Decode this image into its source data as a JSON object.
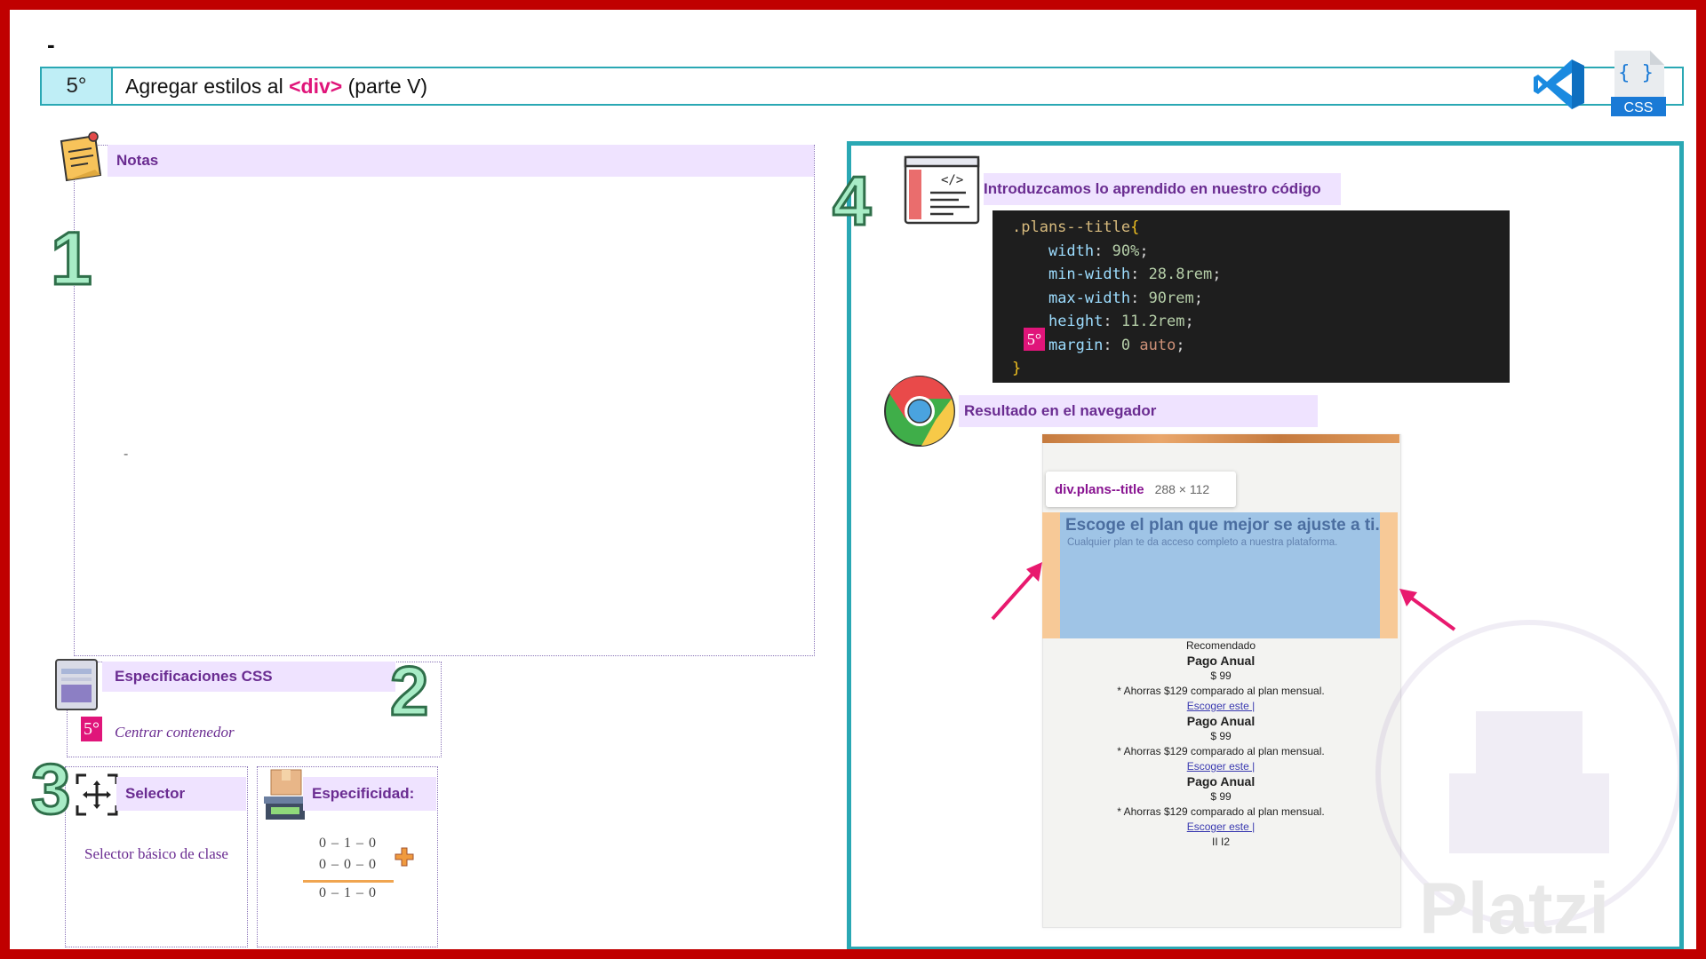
{
  "top_dash": "-",
  "header": {
    "number": "5°",
    "title_prefix": "Agregar estilos al ",
    "title_tag": "<div>",
    "title_suffix": " (parte V)",
    "css_badge": "CSS"
  },
  "notes": {
    "title": "Notas",
    "step": "1",
    "dash": "-"
  },
  "specs": {
    "title": "Especificaciones CSS",
    "step": "2",
    "badge": "5°",
    "item": "Centrar contenedor"
  },
  "selector": {
    "step": "3",
    "title": "Selector",
    "text": "Selector básico de clase"
  },
  "specificity": {
    "title": "Especificidad:",
    "line1": "0 – 1 – 0",
    "line2": "0 – 0 – 0",
    "line3": "0 – 1 – 0"
  },
  "code_section": {
    "step": "4",
    "title": "Introduzcamos lo aprendido en nuestro código",
    "badge": "5°",
    "code": {
      "selector": ".plans--title",
      "open": "{",
      "close": "}",
      "rules": [
        {
          "prop": "width",
          "value": "90%"
        },
        {
          "prop": "min-width",
          "value": "28.8rem"
        },
        {
          "prop": "max-width",
          "value": "90rem"
        },
        {
          "prop": "height",
          "value": "11.2rem"
        },
        {
          "prop": "margin",
          "value_num": "0",
          "value_kw": "auto"
        }
      ]
    }
  },
  "browser_section": {
    "title": "Resultado en el navegador",
    "tooltip_name": "div.plans--title",
    "tooltip_size": "288 × 112",
    "plans_title": "Escoge el plan que mejor se ajuste a ti.",
    "plans_subtitle": "Cualquier plan te da acceso completo a nuestra plataforma.",
    "recommended": "Recomendado",
    "plans": [
      {
        "name": "Pago Anual",
        "price": "$ 99",
        "note": "* Ahorras $129 comparado al plan mensual.",
        "link": "Escoger este |"
      },
      {
        "name": "Pago Anual",
        "price": "$ 99",
        "note": "* Ahorras $129 comparado al plan mensual.",
        "link": "Escoger este |"
      },
      {
        "name": "Pago Anual",
        "price": "$ 99",
        "note": "* Ahorras $129 comparado al plan mensual.",
        "link": "Escoger este |"
      }
    ],
    "footer_text": "II I2"
  },
  "watermark": {
    "text": "Platzi"
  },
  "colors": {
    "frame": "#c00000",
    "accent": "#2aa8b4",
    "pink": "#e0157a",
    "label": "#6a2c91",
    "label_bg": "#efe3ff"
  }
}
